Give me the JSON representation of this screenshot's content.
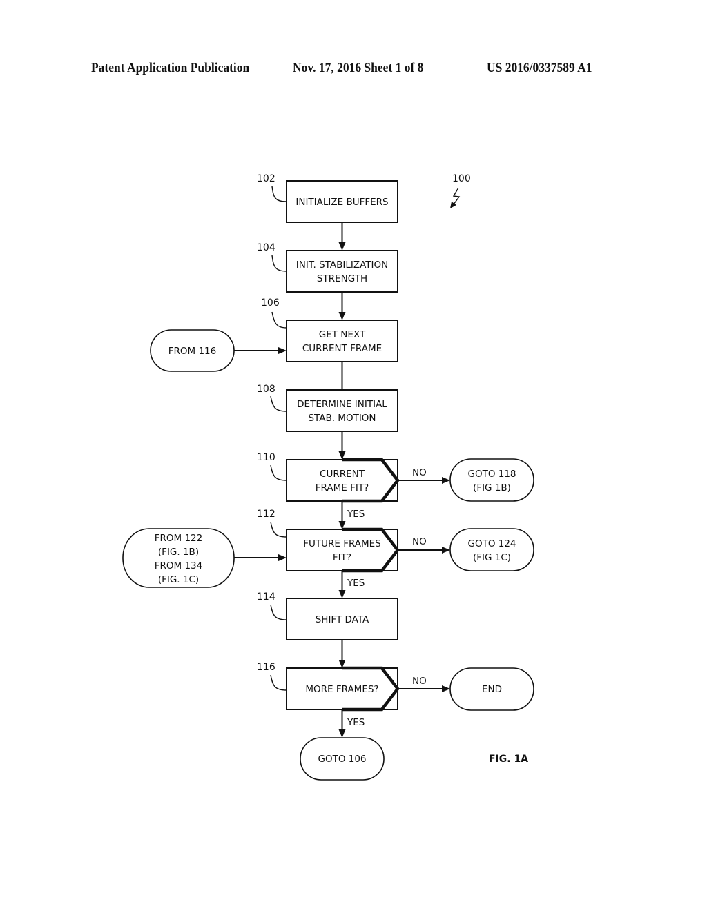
{
  "header": {
    "publication_label": "Patent Application Publication",
    "date_sheet": "Nov. 17, 2016  Sheet 1 of 8",
    "patent_number": "US 2016/0337589 A1"
  },
  "diagram": {
    "reference": "100",
    "figure_label": "FIG. 1A",
    "steps": [
      {
        "ref": "102",
        "type": "process",
        "lines": [
          "INITIALIZE BUFFERS"
        ]
      },
      {
        "ref": "104",
        "type": "process",
        "lines": [
          "INIT. STABILIZATION",
          "STRENGTH"
        ]
      },
      {
        "ref": "106",
        "type": "process",
        "lines": [
          "GET NEXT",
          "CURRENT FRAME"
        ]
      },
      {
        "ref": "108",
        "type": "process",
        "lines": [
          "DETERMINE INITIAL",
          "STAB. MOTION"
        ]
      },
      {
        "ref": "110",
        "type": "decision",
        "lines": [
          "CURRENT",
          "FRAME FIT?"
        ]
      },
      {
        "ref": "112",
        "type": "decision",
        "lines": [
          "FUTURE FRAMES",
          "FIT?"
        ]
      },
      {
        "ref": "114",
        "type": "process",
        "lines": [
          "SHIFT DATA"
        ]
      },
      {
        "ref": "116",
        "type": "decision",
        "lines": [
          "MORE FRAMES?"
        ]
      }
    ],
    "terminals": {
      "from_116": [
        "FROM 116"
      ],
      "from_122_134": [
        "FROM 122",
        "(FIG. 1B)",
        "FROM 134",
        "(FIG. 1C)"
      ],
      "goto_118": [
        "GOTO 118",
        "(FIG 1B)"
      ],
      "goto_124": [
        "GOTO 124",
        "(FIG 1C)"
      ],
      "end": [
        "END"
      ],
      "goto_106": [
        "GOTO 106"
      ]
    },
    "branch_labels": {
      "yes": "YES",
      "no": "NO"
    }
  }
}
